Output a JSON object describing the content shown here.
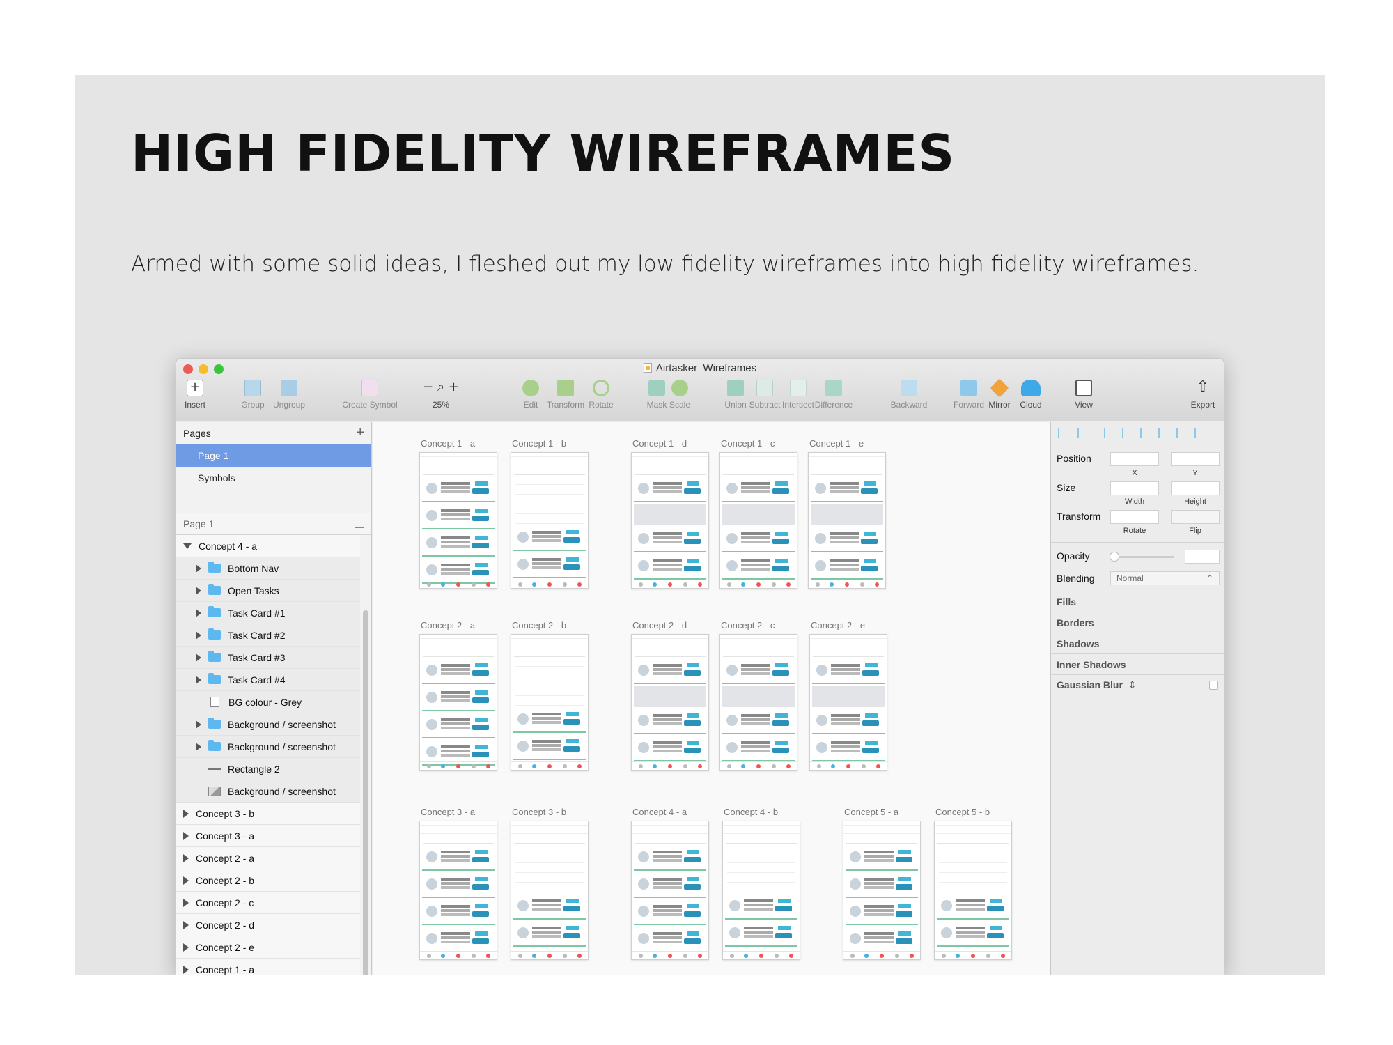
{
  "slide": {
    "heading": "HIGH FIDELITY WIREFRAMES",
    "subtitle": "Armed with some solid ideas, I fleshed out my low fidelity wireframes into high fidelity wireframes."
  },
  "window": {
    "title": "Airtasker_Wireframes",
    "traffic_lights": [
      "#ee5b55",
      "#f5bc2f",
      "#3dc43f"
    ]
  },
  "toolbar": {
    "insert": "Insert",
    "group": "Group",
    "ungroup": "Ungroup",
    "create_symbol": "Create Symbol",
    "zoom_minus": "−",
    "zoom_plus": "+",
    "zoom_level": "25%",
    "edit": "Edit",
    "transform": "Transform",
    "rotate": "Rotate",
    "mask": "Mask",
    "scale": "Scale",
    "union": "Union",
    "subtract": "Subtract",
    "intersect": "Intersect",
    "difference": "Difference",
    "backward": "Backward",
    "forward": "Forward",
    "mirror": "Mirror",
    "cloud": "Cloud",
    "view": "View",
    "export": "Export"
  },
  "pages_panel": {
    "header": "Pages",
    "add": "+",
    "pages": [
      "Page 1",
      "Symbols"
    ],
    "selected": "Page 1"
  },
  "layers_panel": {
    "header": "Page 1",
    "expanded_group": "Concept 4 - a",
    "children": [
      {
        "label": "Bottom Nav",
        "type": "folder"
      },
      {
        "label": "Open Tasks",
        "type": "folder"
      },
      {
        "label": "Task Card #1",
        "type": "folder"
      },
      {
        "label": "Task Card #2",
        "type": "folder"
      },
      {
        "label": "Task Card #3",
        "type": "folder"
      },
      {
        "label": "Task Card #4",
        "type": "folder"
      },
      {
        "label": "BG colour - Grey",
        "type": "rect"
      },
      {
        "label": "Background / screenshot",
        "type": "folder"
      },
      {
        "label": "Background / screenshot",
        "type": "folder"
      },
      {
        "label": "Rectangle 2",
        "type": "line"
      },
      {
        "label": "Background / screenshot",
        "type": "image"
      }
    ],
    "groups": [
      "Concept 3 - b",
      "Concept 3 - a",
      "Concept 2 - a",
      "Concept 2 - b",
      "Concept 2 - c",
      "Concept 2 - d",
      "Concept 2 - e",
      "Concept 1 - a"
    ]
  },
  "artboards": {
    "row1": [
      "Concept 1 - a",
      "Concept 1 - b",
      "Concept 1 - d",
      "Concept 1 - c",
      "Concept 1 - e"
    ],
    "row2": [
      "Concept 2 - a",
      "Concept 2 - b",
      "Concept 2 - d",
      "Concept 2 - c",
      "Concept 2 - e"
    ],
    "row3": [
      "Concept 3 - a",
      "Concept 3 - b",
      "Concept 4 - a",
      "Concept 4 - b",
      "Concept 5 - a",
      "Concept 5 - b"
    ]
  },
  "inspector": {
    "position": "Position",
    "x": "X",
    "y": "Y",
    "size": "Size",
    "width": "Width",
    "height": "Height",
    "transform": "Transform",
    "rotate": "Rotate",
    "flip": "Flip",
    "opacity": "Opacity",
    "blending": "Blending",
    "blending_value": "Normal",
    "fills": "Fills",
    "borders": "Borders",
    "shadows": "Shadows",
    "inner_shadows": "Inner Shadows",
    "gaussian_blur": "Gaussian Blur"
  }
}
